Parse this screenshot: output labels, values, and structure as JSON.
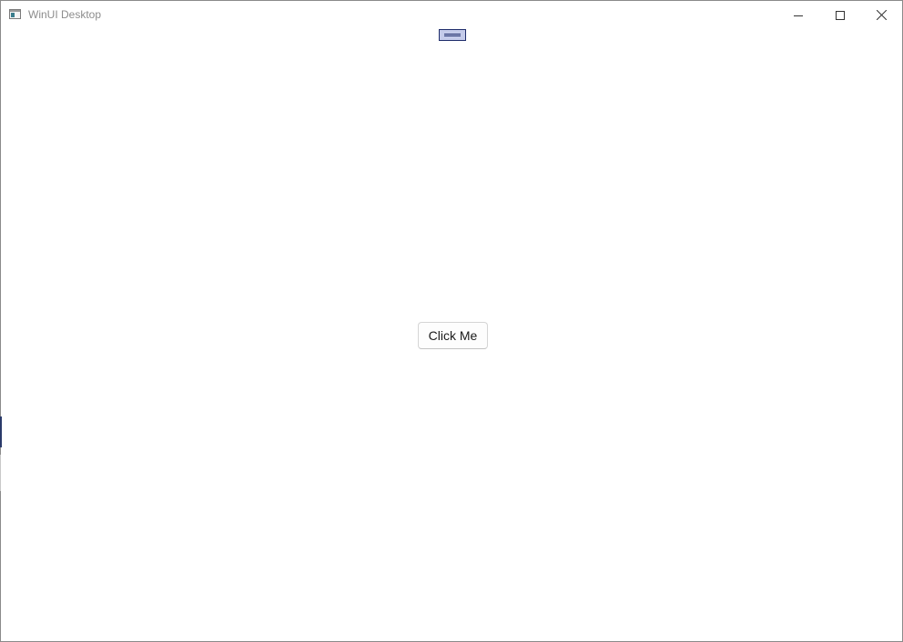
{
  "window": {
    "title": "WinUI Desktop",
    "app_icon": "app-window-icon",
    "caption_buttons": {
      "minimize_icon": "minimize-icon",
      "maximize_icon": "maximize-icon",
      "close_icon": "close-icon"
    }
  },
  "content": {
    "drag_handle_icon": "drag-handle-icon",
    "button_label": "Click Me"
  },
  "colors": {
    "drag_handle_fill": "#c4cbea",
    "drag_handle_border": "#1f2d6b",
    "window_background": "#ffffff",
    "title_text": "#8c8c8c"
  }
}
